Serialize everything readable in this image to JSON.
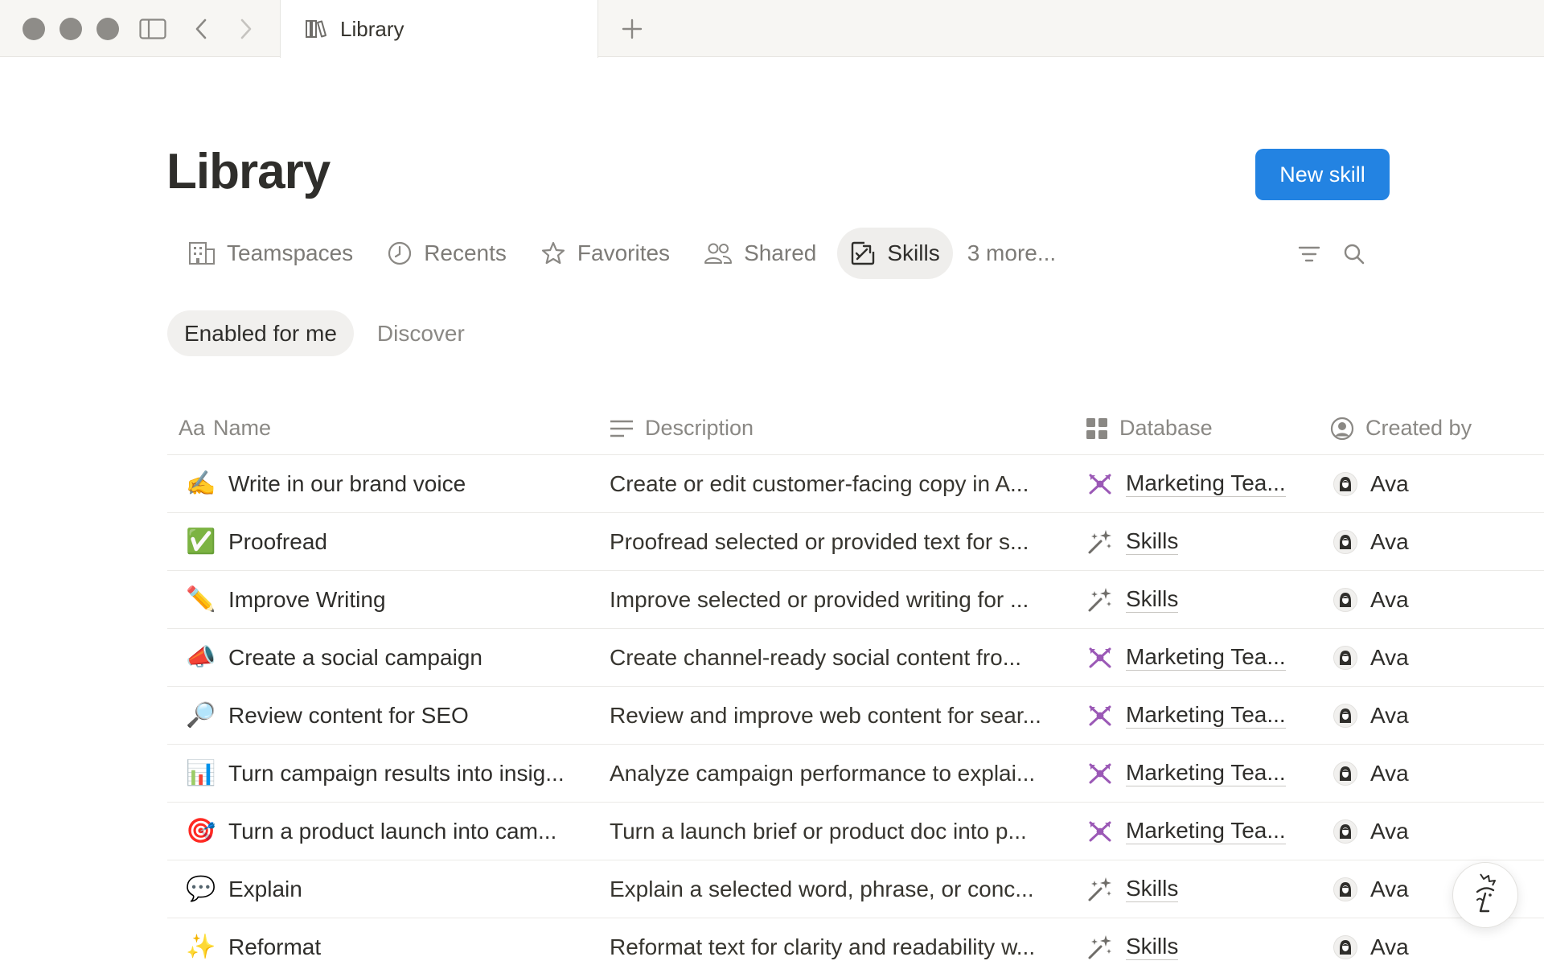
{
  "titlebar": {
    "tab_title": "Library",
    "icons": [
      "sidebar-toggle-icon",
      "back-arrow-icon",
      "forward-arrow-icon",
      "library-icon",
      "plus-icon"
    ]
  },
  "page": {
    "title": "Library",
    "new_button": "New skill"
  },
  "views": [
    {
      "label": "Teamspaces",
      "icon": "building-icon"
    },
    {
      "label": "Recents",
      "icon": "clock-icon"
    },
    {
      "label": "Favorites",
      "icon": "star-icon"
    },
    {
      "label": "Shared",
      "icon": "people-icon"
    },
    {
      "label": "Skills",
      "icon": "skills-icon",
      "active": true
    },
    {
      "label": "3 more..."
    }
  ],
  "subtabs": [
    {
      "label": "Enabled for me",
      "active": true
    },
    {
      "label": "Discover"
    }
  ],
  "table": {
    "columns": [
      {
        "prefix": "Aa",
        "label": "Name"
      },
      {
        "label": "Description",
        "icon": "text-lines-icon"
      },
      {
        "label": "Database",
        "icon": "grid-icon"
      },
      {
        "label": "Created by",
        "icon": "person-circle-icon"
      }
    ],
    "rows": [
      {
        "emoji": "✍️",
        "name": "Write in our brand voice",
        "description": "Create or edit customer-facing copy in A...",
        "database": "Marketing Tea...",
        "db_icon": "marketing-icon",
        "created_by": "Ava"
      },
      {
        "emoji": "✅",
        "name": "Proofread",
        "description": "Proofread selected or provided text for s...",
        "database": "Skills",
        "db_icon": "sparkle-wand-icon",
        "created_by": "Ava"
      },
      {
        "emoji": "✏️",
        "name": "Improve Writing",
        "description": "Improve selected or provided writing for ...",
        "database": "Skills",
        "db_icon": "sparkle-wand-icon",
        "created_by": "Ava"
      },
      {
        "emoji": "📣",
        "name": "Create a social campaign",
        "description": "Create channel-ready social content fro...",
        "database": "Marketing Tea...",
        "db_icon": "marketing-icon",
        "created_by": "Ava"
      },
      {
        "emoji": "🔎",
        "name": "Review content for SEO",
        "description": "Review and improve web content for sear...",
        "database": "Marketing Tea...",
        "db_icon": "marketing-icon",
        "created_by": "Ava"
      },
      {
        "emoji": "📊",
        "name": "Turn campaign results into insig...",
        "description": "Analyze campaign performance to explai...",
        "database": "Marketing Tea...",
        "db_icon": "marketing-icon",
        "created_by": "Ava"
      },
      {
        "emoji": "🎯",
        "name": "Turn a product launch into cam...",
        "description": "Turn a launch brief or product doc into p...",
        "database": "Marketing Tea...",
        "db_icon": "marketing-icon",
        "created_by": "Ava"
      },
      {
        "emoji": "💬",
        "name": "Explain",
        "description": "Explain a selected word, phrase, or conc...",
        "database": "Skills",
        "db_icon": "sparkle-wand-icon",
        "created_by": "Ava"
      },
      {
        "emoji": "✨",
        "name": "Reformat",
        "description": "Reformat text for clarity and readability w...",
        "database": "Skills",
        "db_icon": "sparkle-wand-icon",
        "created_by": "Ava"
      }
    ]
  },
  "colors": {
    "accent": "#2383e2",
    "marketing_icon": "#9b59b6",
    "text_primary": "#2f2e2b",
    "text_muted": "#8a8884"
  }
}
